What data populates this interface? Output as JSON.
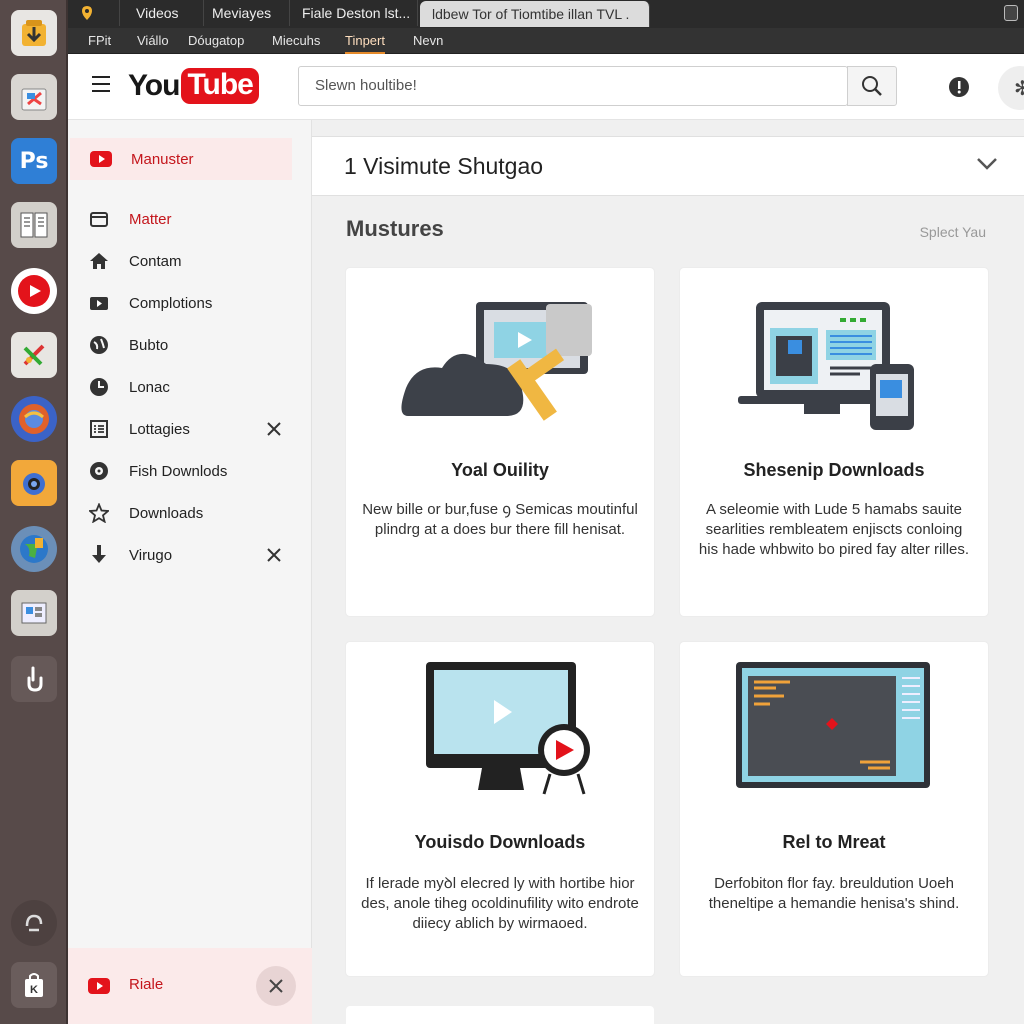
{
  "tabs": [
    {
      "label": "Videos"
    },
    {
      "label": "Meviayes"
    },
    {
      "label": "Fiale Deston lst..."
    },
    {
      "label": "ldbew Tor of Tiomtibe illan TVL ."
    }
  ],
  "menu": [
    {
      "label": "FPit"
    },
    {
      "label": "Viállo"
    },
    {
      "label": "Dóugatop"
    },
    {
      "label": "Miecuhs"
    },
    {
      "label": "Tinpert"
    },
    {
      "label": "Nevn"
    }
  ],
  "header": {
    "logo_you": "You",
    "logo_tube": "Tube",
    "search_placeholder": "Slewn houltibe!"
  },
  "sidebar": {
    "items": [
      {
        "label": "Manuster",
        "icon": "youtube-play-icon"
      },
      {
        "label": "Matter",
        "icon": "folder-icon"
      },
      {
        "label": "Contam",
        "icon": "home-icon"
      },
      {
        "label": "Complotions",
        "icon": "video-camera-icon"
      },
      {
        "label": "Bubto",
        "icon": "globe-icon"
      },
      {
        "label": "Lonac",
        "icon": "clock-icon"
      },
      {
        "label": "Lottagies",
        "icon": "list-icon"
      },
      {
        "label": "Fish Downlods",
        "icon": "disc-icon"
      },
      {
        "label": "Downloads",
        "icon": "star-icon"
      },
      {
        "label": "Virugo",
        "icon": "download-arrow-icon"
      }
    ],
    "footer_label": "Riale"
  },
  "main": {
    "playlist_title": "1 Visimute Shutgao",
    "section_title": "Mustures",
    "select_label": "Splect Yau",
    "cards": [
      {
        "title": "Yoal Ouility",
        "text": "New bille or bur,fuse ꝯ Semicas moutinful plindrg at a does bur there fill henisat."
      },
      {
        "title": "Shesenip Downloads",
        "text": "A seleomie with Lude 5 hamabs sauite searlities rembleatem enjiscts conloing his hade whbwito bo pired fay alter rilles."
      },
      {
        "title": "Youisdo Downloads",
        "text": "If lerade myꝺl elecred ly with hortibe hior des, anole tiheg ocoldinufility wito endrote diiecy ablich by wirmaoed."
      },
      {
        "title": "Rel to Mreat",
        "text": "Derfobiton flor fay. breuldution Uoeh theneltipe a hemandie henisa's shind."
      }
    ]
  },
  "colors": {
    "brand_red": "#e3131b",
    "accent_orange": "#e58a2a",
    "dock_bg": "#574a49"
  }
}
